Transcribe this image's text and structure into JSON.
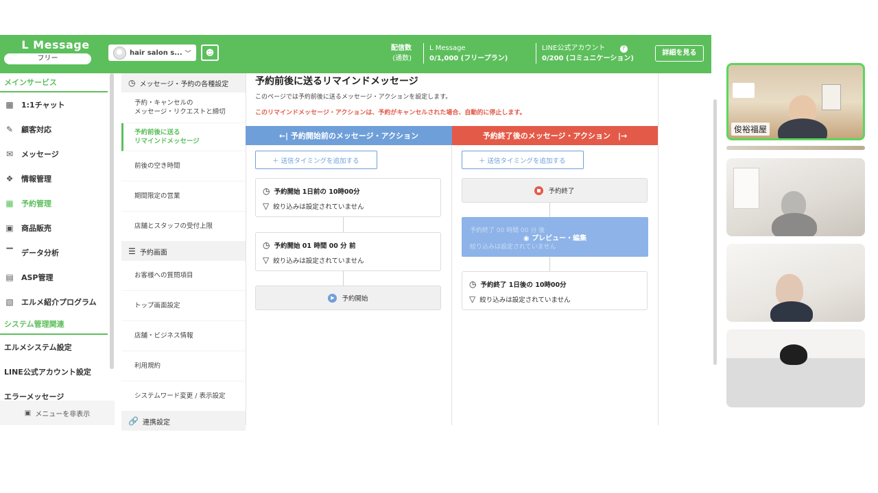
{
  "header": {
    "brand": "L Message",
    "plan": "フリー",
    "account_name": "hair salon s...",
    "sent_label": "配信数",
    "sent_sublabel": "(通数)",
    "lmessage_label": "L Message",
    "lmessage_value": "0/1,000 (フリープラン)",
    "line_label": "LINE公式アカウント",
    "line_value": "0/200 (コミュニケーション)",
    "detail_button": "詳細を見る"
  },
  "sidebar": {
    "main_section": "メインサービス",
    "items": [
      {
        "label": "1:1チャット",
        "icon": "chat-icon"
      },
      {
        "label": "顧客対応",
        "icon": "edit-icon"
      },
      {
        "label": "メッセージ",
        "icon": "message-icon"
      },
      {
        "label": "情報管理",
        "icon": "tag-icon"
      },
      {
        "label": "予約管理",
        "icon": "calendar-icon",
        "active": true
      },
      {
        "label": "商品販売",
        "icon": "cart-icon"
      },
      {
        "label": "データ分析",
        "icon": "chart-icon"
      },
      {
        "label": "ASP管理",
        "icon": "asp-icon"
      },
      {
        "label": "エルメ紹介プログラム",
        "icon": "badge-icon"
      }
    ],
    "system_section": "システム管理関連",
    "system_items": [
      "エルメシステム設定",
      "LINE公式アカウント設定",
      "エラーメッセージ"
    ],
    "hide_menu": "メニューを非表示"
  },
  "submenu": {
    "group1": "メッセージ・予約の各種設定",
    "items1": [
      "予約・キャンセルの\nメッセージ・リクエストと締切",
      "予約前後に送る\nリマインドメッセージ",
      "前後の空き時間",
      "期間限定の営業",
      "店舗とスタッフの受付上限"
    ],
    "group2": "予約画面",
    "items2": [
      "お客様への質問項目",
      "トップ画面設定",
      "店舗・ビジネス情報",
      "利用規約",
      "システムワード変更 / 表示設定"
    ],
    "group3": "連携設定"
  },
  "main": {
    "title": "予約前後に送るリマインドメッセージ",
    "description": "このページでは予約前後に送るメッセージ・アクションを設定します。",
    "warning": "このリマインドメッセージ・アクションは、予約がキャンセルされた場合、自動的に停止します。",
    "before_header": "←| 予約開始前のメッセージ・アクション",
    "after_header": "予約終了後のメッセージ・アクション　|→",
    "add_timing": "＋ 送信タイミングを追加する",
    "before_cards": [
      {
        "time": "予約開始 1日前の 10時00分",
        "filter": "絞り込みは設定されていません"
      },
      {
        "time": "予約開始 01 時間 00 分 前",
        "filter": "絞り込みは設定されていません"
      }
    ],
    "before_end": "予約開始",
    "after_start": "予約終了",
    "ghost_time": "予約終了 00 時間 00 分 後",
    "ghost_filter": "絞り込みは設定されていません",
    "ghost_overlay": "プレビュー・編集",
    "after_cards": [
      {
        "time": "予約終了 1日後の 10時00分",
        "filter": "絞り込みは設定されていません"
      }
    ]
  },
  "video": {
    "participant1": "俊裕福屋"
  },
  "colors": {
    "brand_green": "#5cbf5c",
    "before_blue": "#6f9fd9",
    "after_red": "#e45a48"
  }
}
